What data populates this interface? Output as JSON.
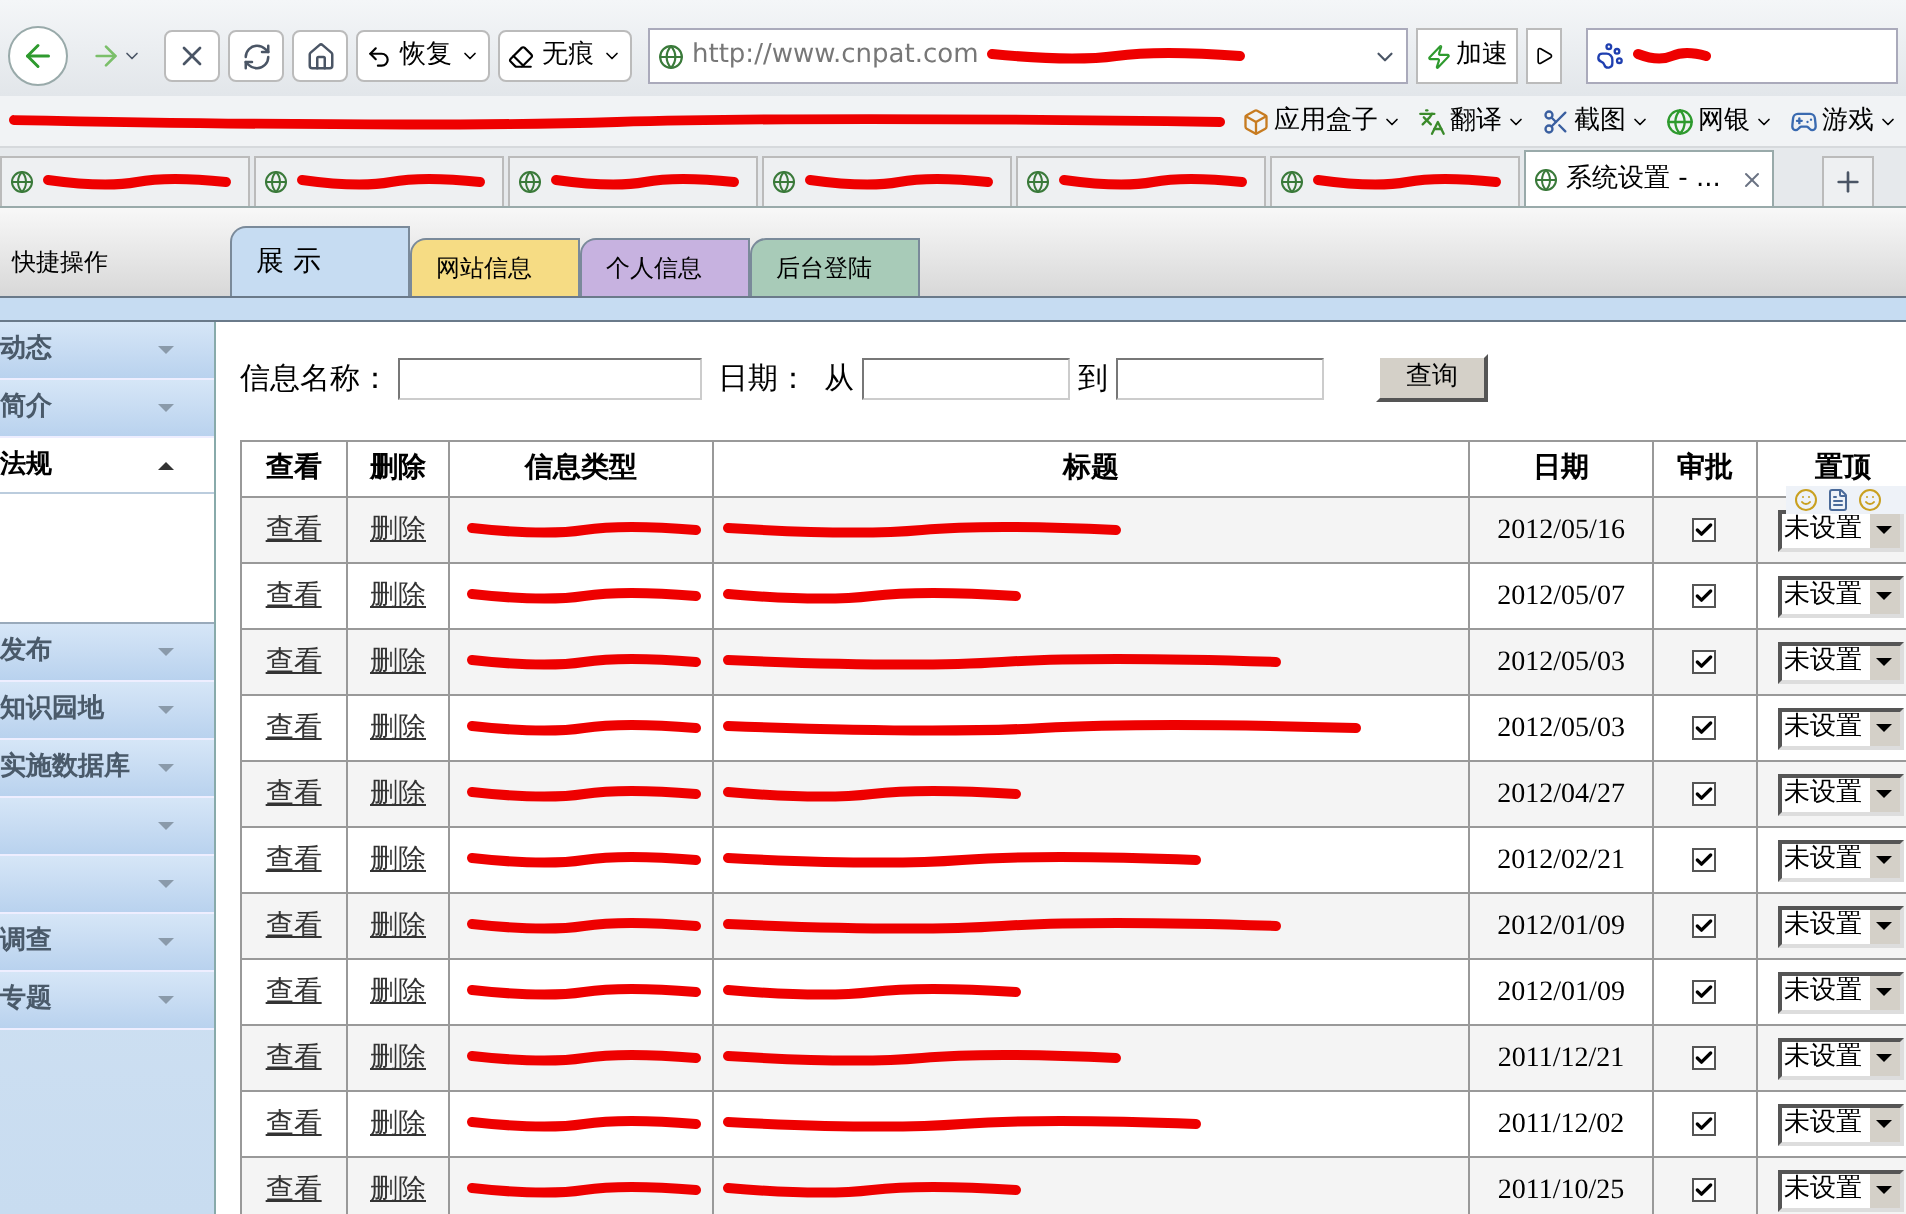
{
  "browser": {
    "restore_label": "恢复",
    "private_label": "无痕",
    "address": "http://www.cnpat.com",
    "speed_label": "加速",
    "bookmarks": [
      {
        "kind": "box",
        "label": "应用盒子"
      },
      {
        "kind": "translate",
        "label": "翻译"
      },
      {
        "kind": "screenshot",
        "label": "截图"
      },
      {
        "kind": "bank",
        "label": "网银"
      },
      {
        "kind": "game",
        "label": "游戏"
      }
    ],
    "tabs": [
      {
        "selected": false
      },
      {
        "selected": false
      },
      {
        "selected": false
      },
      {
        "selected": false
      },
      {
        "selected": false
      },
      {
        "selected": false
      },
      {
        "title": "系统设置 - ...",
        "selected": true
      }
    ]
  },
  "header": {
    "quick_ops": "快捷操作",
    "tabs": [
      {
        "label": "展 示",
        "selected": true,
        "color": "#c6dcf2"
      },
      {
        "label": "网站信息",
        "selected": false,
        "color": "#f6dc84"
      },
      {
        "label": "个人信息",
        "selected": false,
        "color": "#c7b2e0"
      },
      {
        "label": "后台登陆",
        "selected": false,
        "color": "#a8cbb8"
      }
    ]
  },
  "sidebar": {
    "items": [
      {
        "label": "动态",
        "expanded": false
      },
      {
        "label": "简介",
        "expanded": false
      },
      {
        "label": "法规",
        "expanded": true
      },
      {
        "label": "发布",
        "expanded": false
      },
      {
        "label": "知识园地",
        "expanded": false
      },
      {
        "label": "实施数据库",
        "expanded": false
      },
      {
        "expanded": false
      },
      {
        "expanded": false
      },
      {
        "label": "调查",
        "expanded": false
      },
      {
        "label": "专题",
        "expanded": false
      }
    ]
  },
  "search": {
    "name_label": "信息名称：",
    "date_label": "日期：",
    "from_label": "从",
    "to_label": "到",
    "button": "查询"
  },
  "table": {
    "columns": [
      "查看",
      "删除",
      "信息类型",
      "标题",
      "日期",
      "审批",
      "置顶"
    ],
    "rows": [
      {
        "view": "查看",
        "delete": "删除",
        "date": "2012/05/16",
        "approved": true,
        "pin": "未设置"
      },
      {
        "view": "查看",
        "delete": "删除",
        "date": "2012/05/07",
        "approved": true,
        "pin": "未设置"
      },
      {
        "view": "查看",
        "delete": "删除",
        "date": "2012/05/03",
        "approved": true,
        "pin": "未设置"
      },
      {
        "view": "查看",
        "delete": "删除",
        "date": "2012/05/03",
        "approved": true,
        "pin": "未设置"
      },
      {
        "view": "查看",
        "delete": "删除",
        "date": "2012/04/27",
        "approved": true,
        "pin": "未设置"
      },
      {
        "view": "查看",
        "delete": "删除",
        "date": "2012/02/21",
        "approved": true,
        "pin": "未设置"
      },
      {
        "view": "查看",
        "delete": "删除",
        "date": "2012/01/09",
        "approved": true,
        "pin": "未设置"
      },
      {
        "view": "查看",
        "delete": "删除",
        "date": "2012/01/09",
        "approved": true,
        "pin": "未设置"
      },
      {
        "view": "查看",
        "delete": "删除",
        "date": "2011/12/21",
        "approved": true,
        "pin": "未设置"
      },
      {
        "view": "查看",
        "delete": "删除",
        "date": "2011/12/02",
        "approved": true,
        "pin": "未设置"
      },
      {
        "view": "查看",
        "delete": "删除",
        "date": "2011/10/25",
        "approved": true,
        "pin": "未设置"
      }
    ]
  }
}
